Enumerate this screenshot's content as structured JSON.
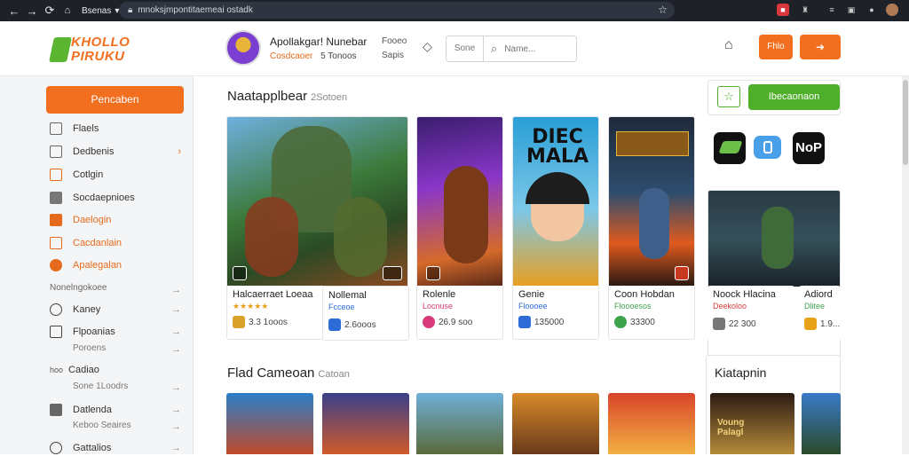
{
  "browser": {
    "tab_label": "Bsenas",
    "address": "mnoksjmpontitaemeai ostadk",
    "ext_colors": [
      "#d9363e",
      "#8a8a8a",
      "#cfcfcf",
      "#cfcfcf",
      "#cfcfcf"
    ]
  },
  "header": {
    "logo_line1": "KHOLLO",
    "logo_line2": "PIRUKU",
    "app_title": "Apollakgar! Nunebar",
    "app_sub1": "Cosdcaoer",
    "app_sub2": "5 Tonoos",
    "extra1": "Fooeo",
    "extra2": "Sapis",
    "search_scope": "Sone",
    "search_placeholder": "Name...",
    "btn_small": "Fhlo",
    "btn_large": "➜"
  },
  "sidebar": {
    "primary_button": "Pencaben",
    "items": [
      {
        "label": "Flaels",
        "icon": "list-icon",
        "color": "#666"
      },
      {
        "label": "Dedbenis",
        "icon": "grid-icon",
        "color": "#666",
        "arrow": "›"
      },
      {
        "label": "Cotlgin",
        "icon": "mail-icon",
        "color": "#e66a1c"
      },
      {
        "label": "Socdaepnioes",
        "icon": "store-icon",
        "color": "#666"
      },
      {
        "label": "Daelogin",
        "icon": "tag-icon",
        "color": "#e66a1c"
      },
      {
        "label": "Cacdanlain",
        "icon": "cart-icon",
        "color": "#e66a1c"
      },
      {
        "label": "Apalegalan",
        "icon": "circle-icon",
        "color": "#e66a1c"
      }
    ],
    "section_head": "Nonelngokoee",
    "items2": [
      {
        "label": "Kaney",
        "icon": "globe-icon"
      },
      {
        "label": "Flpoanias",
        "icon": "link-icon"
      },
      {
        "label": "Cadiao",
        "icon": "text-icon",
        "prefix": "hoo"
      },
      {
        "label": "Datlenda",
        "icon": "box-icon"
      },
      {
        "label": "Gattalios",
        "icon": "gear-icon"
      }
    ],
    "sub_rows": [
      "Poroens",
      "Sone 1Loodrs",
      "Keboo Seaires"
    ]
  },
  "main": {
    "section1_title": "Naatapplbear",
    "section1_sub": "2Sotoen",
    "section2_title": "Flad Cameoan",
    "section2_sub": "Catoan",
    "cards": [
      {
        "name": "Halcaerraet Loeaa",
        "stars": "★★★★★",
        "meta": "3.3 1ooos",
        "ribbon": "#6b3ecf",
        "meta_color": "#d8a22a"
      },
      {
        "name": "Nollemal",
        "stars": "Fcceoe",
        "meta": "2.6ooos",
        "ribbon": "#2d6bd6",
        "meta_color": "#2d6bd6"
      },
      {
        "name": "Rolenle",
        "stars": "Locnuse",
        "meta": "26.9 soo",
        "ribbon": "#d93b7a",
        "meta_color": "#d93b7a"
      },
      {
        "name": "Genie",
        "stars": "Floooee",
        "meta": "135000",
        "ribbon": "#2d6bd6",
        "meta_color": "#2d6bd6"
      },
      {
        "name": "Coon Hobdan",
        "stars": "Floooesos",
        "meta": "33300",
        "ribbon": "#3fa34d",
        "meta_color": "#3fa34d"
      },
      {
        "name": "Noock Hlacina",
        "stars": "Deekoloo",
        "meta": "22 300",
        "ribbon": "#555",
        "meta_color": "#777"
      },
      {
        "name": "Adiord",
        "stars": "Dlitee",
        "meta": "1.9...",
        "ribbon": "#e8a21a",
        "meta_color": "#e8a21a"
      }
    ],
    "art_banner": "DIEC MALA"
  },
  "right": {
    "button": "Ibecaonaon",
    "app_label": "NoP",
    "panel_title": "Kiatapnin",
    "poster_text": "Voung Palagl"
  }
}
